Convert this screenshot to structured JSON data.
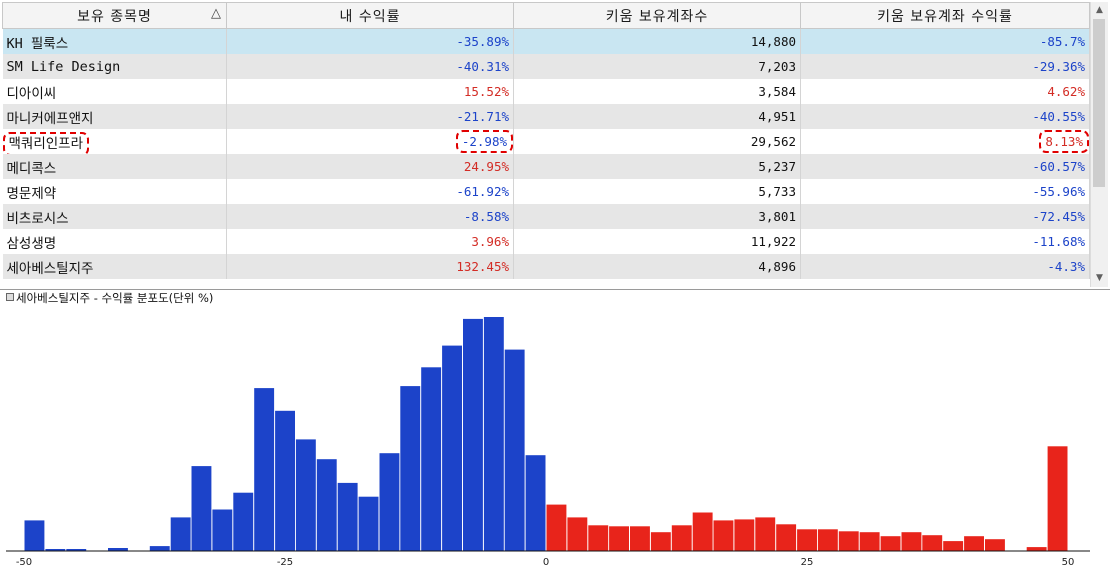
{
  "table": {
    "headers": [
      "보유 종목명",
      "내 수익률",
      "키움 보유계좌수",
      "키움 보유계좌 수익률"
    ],
    "sort_indicator": "△",
    "rows": [
      {
        "name": "KH 필룩스",
        "my_return": "-35.89%",
        "accounts": "14,880",
        "kiwoom_return": "-85.7%"
      },
      {
        "name": "SM Life Design",
        "my_return": "-40.31%",
        "accounts": "7,203",
        "kiwoom_return": "-29.36%"
      },
      {
        "name": "디아이씨",
        "my_return": "15.52%",
        "accounts": "3,584",
        "kiwoom_return": "4.62%"
      },
      {
        "name": "마니커에프앤지",
        "my_return": "-21.71%",
        "accounts": "4,951",
        "kiwoom_return": "-40.55%"
      },
      {
        "name": "맥쿼리인프라",
        "my_return": "-2.98%",
        "accounts": "29,562",
        "kiwoom_return": "8.13%"
      },
      {
        "name": "메디콕스",
        "my_return": "24.95%",
        "accounts": "5,237",
        "kiwoom_return": "-60.57%"
      },
      {
        "name": "명문제약",
        "my_return": "-61.92%",
        "accounts": "5,733",
        "kiwoom_return": "-55.96%"
      },
      {
        "name": "비츠로시스",
        "my_return": "-8.58%",
        "accounts": "3,801",
        "kiwoom_return": "-72.45%"
      },
      {
        "name": "삼성생명",
        "my_return": "3.96%",
        "accounts": "11,922",
        "kiwoom_return": "-11.68%"
      },
      {
        "name": "세아베스틸지주",
        "my_return": "132.45%",
        "accounts": "4,896",
        "kiwoom_return": "-4.3%"
      }
    ],
    "selected_row": 0,
    "highlighted_row": 4
  },
  "colors": {
    "negative": "#1c43c9",
    "positive": "#d32c25",
    "selected_row": "#c9e6f2",
    "highlight_dash": "#e00000"
  },
  "chart_data": {
    "type": "bar",
    "title": "세아베스틸지주 - 수익률 분포도(단위 %)",
    "x_ticks": [
      "-50",
      "-25",
      "0",
      "25",
      "50"
    ],
    "xlim": [
      -50,
      50
    ],
    "bin_width": 2,
    "x": [
      -49,
      -47,
      -45,
      -43,
      -41,
      -39,
      -37,
      -35,
      -33,
      -31,
      -29,
      -27,
      -25,
      -23,
      -21,
      -19,
      -17,
      -15,
      -13,
      -11,
      -9,
      -7,
      -5,
      -3,
      -1,
      1,
      3,
      5,
      7,
      9,
      11,
      13,
      15,
      17,
      19,
      21,
      23,
      25,
      27,
      29,
      31,
      33,
      35,
      37,
      39,
      41,
      43,
      45,
      47,
      49,
      51
    ],
    "values": [
      31,
      2,
      2,
      0,
      3,
      0,
      5,
      34,
      86,
      42,
      59,
      165,
      142,
      113,
      93,
      69,
      55,
      99,
      167,
      186,
      208,
      235,
      237,
      204,
      97,
      47,
      34,
      26,
      25,
      25,
      19,
      26,
      39,
      31,
      32,
      34,
      27,
      22,
      22,
      20,
      19,
      15,
      19,
      16,
      10,
      15,
      12,
      0,
      4,
      106
    ],
    "ylim": [
      0,
      240
    ],
    "series_colors": {
      "negative": "#1c43c9",
      "positive": "#e8241b"
    },
    "grid": false,
    "legend": "none"
  }
}
